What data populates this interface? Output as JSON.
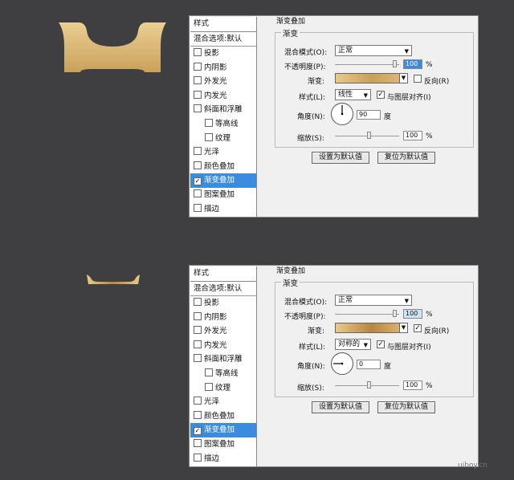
{
  "panels": [
    {
      "section_title": "渐变叠加",
      "sidebar": {
        "header": "样式",
        "blend": "混合选项:默认",
        "items": [
          {
            "label": "投影",
            "checked": false,
            "indent": false,
            "active": false
          },
          {
            "label": "内阴影",
            "checked": false,
            "indent": false,
            "active": false
          },
          {
            "label": "外发光",
            "checked": false,
            "indent": false,
            "active": false
          },
          {
            "label": "内发光",
            "checked": false,
            "indent": false,
            "active": false
          },
          {
            "label": "斜面和浮雕",
            "checked": false,
            "indent": false,
            "active": false
          },
          {
            "label": "等高线",
            "checked": false,
            "indent": true,
            "active": false
          },
          {
            "label": "纹理",
            "checked": false,
            "indent": true,
            "active": false
          },
          {
            "label": "光泽",
            "checked": false,
            "indent": false,
            "active": false
          },
          {
            "label": "颜色叠加",
            "checked": false,
            "indent": false,
            "active": false
          },
          {
            "label": "渐变叠加",
            "checked": true,
            "indent": false,
            "active": true
          },
          {
            "label": "图案叠加",
            "checked": false,
            "indent": false,
            "active": false
          },
          {
            "label": "描边",
            "checked": false,
            "indent": false,
            "active": false
          }
        ]
      },
      "group_title": "渐变",
      "blend_mode_label": "混合模式(O):",
      "blend_mode_value": "正常",
      "opacity_label": "不透明度(P):",
      "opacity_value": "100",
      "opacity_unit": "%",
      "gradient_label": "渐变:",
      "reverse_label": "反向(R)",
      "reverse_checked": false,
      "style_label": "样式(L):",
      "style_value": "线性",
      "align_label": "与图层对齐(I)",
      "align_checked": true,
      "angle_label": "角度(N):",
      "angle_value": "90",
      "angle_unit": "度",
      "scale_label": "缩放(S):",
      "scale_value": "100",
      "scale_unit": "%",
      "btn_default": "设置为默认值",
      "btn_reset": "复位为默认值",
      "gradient_colors": [
        "#e9c98a",
        "#c9a15a",
        "#e2b978"
      ],
      "opacity_selected": true
    },
    {
      "section_title": "渐变叠加",
      "sidebar": {
        "header": "样式",
        "blend": "混合选项:默认",
        "items": [
          {
            "label": "投影",
            "checked": false,
            "indent": false,
            "active": false
          },
          {
            "label": "内阴影",
            "checked": false,
            "indent": false,
            "active": false
          },
          {
            "label": "外发光",
            "checked": false,
            "indent": false,
            "active": false
          },
          {
            "label": "内发光",
            "checked": false,
            "indent": false,
            "active": false
          },
          {
            "label": "斜面和浮雕",
            "checked": false,
            "indent": false,
            "active": false
          },
          {
            "label": "等高线",
            "checked": false,
            "indent": true,
            "active": false
          },
          {
            "label": "纹理",
            "checked": false,
            "indent": true,
            "active": false
          },
          {
            "label": "光泽",
            "checked": false,
            "indent": false,
            "active": false
          },
          {
            "label": "颜色叠加",
            "checked": false,
            "indent": false,
            "active": false
          },
          {
            "label": "渐变叠加",
            "checked": true,
            "indent": false,
            "active": true
          },
          {
            "label": "图案叠加",
            "checked": false,
            "indent": false,
            "active": false
          },
          {
            "label": "描边",
            "checked": false,
            "indent": false,
            "active": false
          }
        ]
      },
      "group_title": "渐变",
      "blend_mode_label": "混合模式(O):",
      "blend_mode_value": "正常",
      "opacity_label": "不透明度(P):",
      "opacity_value": "100",
      "opacity_unit": "%",
      "gradient_label": "渐变:",
      "reverse_label": "反向(R)",
      "reverse_checked": true,
      "style_label": "样式(L):",
      "style_value": "对称的",
      "align_label": "与图层对齐(I)",
      "align_checked": true,
      "angle_label": "角度(N):",
      "angle_value": "0",
      "angle_unit": "度",
      "scale_label": "缩放(S):",
      "scale_value": "100",
      "scale_unit": "%",
      "btn_default": "设置为默认值",
      "btn_reset": "复位为默认值",
      "gradient_colors": [
        "#e9c98a",
        "#b8863f",
        "#e2b978"
      ],
      "opacity_selected": false
    }
  ],
  "watermark": "uiboy.cn",
  "colors": {
    "background": "#3f3f41",
    "accent": "#3a8dde",
    "gold_light": "#e9c98a",
    "gold_dark": "#c9a15a"
  }
}
